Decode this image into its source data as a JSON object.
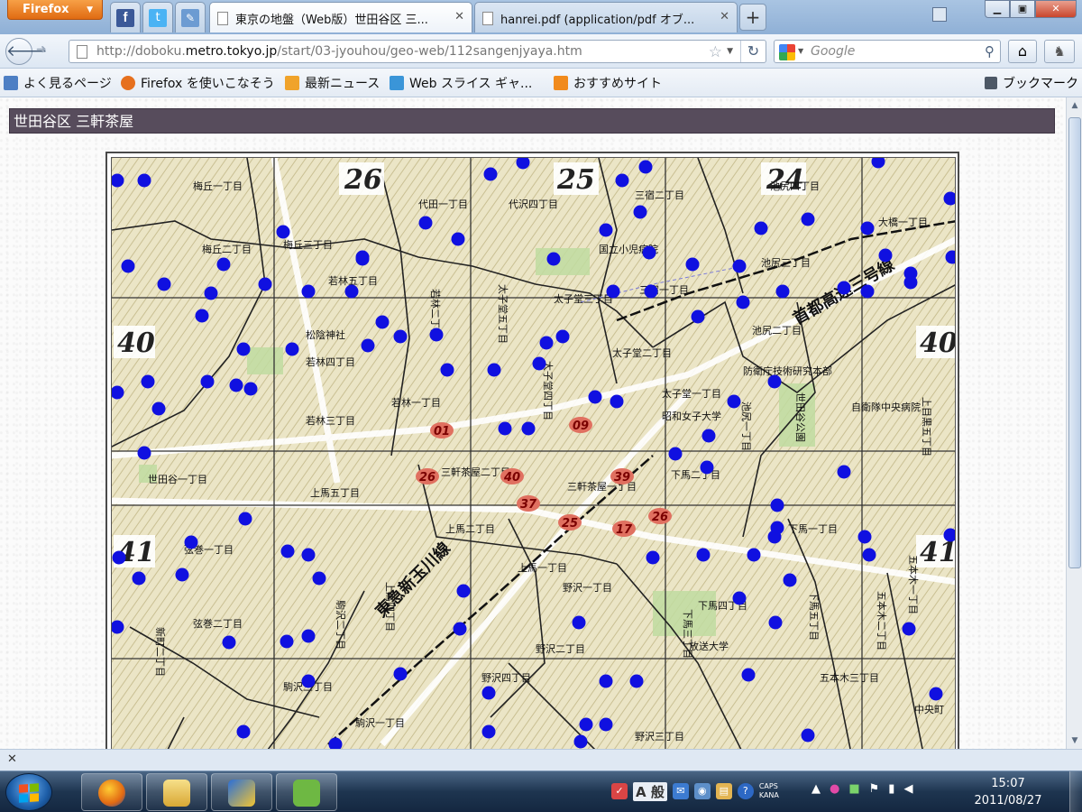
{
  "browser": {
    "menu_button": "Firefox",
    "tabs": [
      {
        "label": "東京の地盤（Web版）世田谷区 三...",
        "active": true
      },
      {
        "label": "hanrei.pdf (application/pdf オブ...",
        "active": false
      }
    ],
    "new_tab": "+",
    "url_host_prefix": "http://doboku.",
    "url_host_domain": "metro.tokyo.jp",
    "url_path": "/start/03-jyouhou/geo-web/112sangenjyaya.htm",
    "search_placeholder": "Google"
  },
  "bookmarks": [
    {
      "label": "よく見るページ",
      "icon": "bookmark-page-icon",
      "color": "#4d7fc4"
    },
    {
      "label": "Firefox を使いこなそう",
      "icon": "firefox-icon",
      "color": "#e6701e"
    },
    {
      "label": "最新ニュース",
      "icon": "rss-icon",
      "color": "#f0a32b"
    },
    {
      "label": "Web スライス ギャ...",
      "icon": "webslice-icon",
      "color": "#3a95d8"
    },
    {
      "label": "おすすめサイト",
      "icon": "bulb-icon",
      "color": "#f18a1c"
    }
  ],
  "bookmarks_menu": "ブックマーク",
  "page": {
    "title": "世田谷区 三軒茶屋"
  },
  "map": {
    "grid_numbers": {
      "top": [
        "26",
        "25",
        "24"
      ],
      "left": [
        "40",
        "41"
      ],
      "right": [
        "40",
        "41"
      ]
    },
    "place_labels": [
      {
        "text": "梅丘一丁目"
      },
      {
        "text": "代田一丁目"
      },
      {
        "text": "代沢四丁目"
      },
      {
        "text": "三宿二丁目"
      },
      {
        "text": "池尻四丁目"
      },
      {
        "text": "大橋一丁目"
      },
      {
        "text": "梅丘二丁目"
      },
      {
        "text": "梅丘三丁目"
      },
      {
        "text": "若林五丁目"
      },
      {
        "text": "若林二丁目"
      },
      {
        "text": "国立小児病院"
      },
      {
        "text": "三宿一丁目"
      },
      {
        "text": "池尻三丁目"
      },
      {
        "text": "池尻二丁目"
      },
      {
        "text": "太子堂五丁目"
      },
      {
        "text": "太子堂三丁目"
      },
      {
        "text": "太子堂二丁目"
      },
      {
        "text": "太子堂四丁目"
      },
      {
        "text": "太子堂一丁目"
      },
      {
        "text": "松陰神社"
      },
      {
        "text": "若林四丁目"
      },
      {
        "text": "若林一丁目"
      },
      {
        "text": "若林三丁目"
      },
      {
        "text": "防衛庁技術研究本部"
      },
      {
        "text": "昭和女子大学"
      },
      {
        "text": "自衛隊中央病院"
      },
      {
        "text": "世田谷一丁目"
      },
      {
        "text": "三軒茶屋二丁目"
      },
      {
        "text": "三軒茶屋一丁目"
      },
      {
        "text": "上馬五丁目"
      },
      {
        "text": "下馬二丁目"
      },
      {
        "text": "上馬二丁目"
      },
      {
        "text": "下馬一丁目"
      },
      {
        "text": "弦巻一丁目"
      },
      {
        "text": "上馬一丁目"
      },
      {
        "text": "野沢一丁目"
      },
      {
        "text": "弦巻二丁目"
      },
      {
        "text": "駒沢二丁目"
      },
      {
        "text": "上馬四丁目"
      },
      {
        "text": "下馬三丁目"
      },
      {
        "text": "下馬四丁目"
      },
      {
        "text": "下馬五丁目"
      },
      {
        "text": "五本木二丁目"
      },
      {
        "text": "新町二丁目"
      },
      {
        "text": "野沢二丁目"
      },
      {
        "text": "放送大学"
      },
      {
        "text": "五本木三丁目"
      },
      {
        "text": "駒沢三丁目"
      },
      {
        "text": "野沢四丁目"
      },
      {
        "text": "駒沢一丁目"
      },
      {
        "text": "野沢三丁目"
      },
      {
        "text": "中央町"
      },
      {
        "text": "東急新玉川線"
      },
      {
        "text": "首都高速三号線"
      },
      {
        "text": "上目黒五丁目"
      },
      {
        "text": "五本木一丁目"
      },
      {
        "text": "世田谷公園"
      },
      {
        "text": "池尻一丁目"
      }
    ],
    "boring_labels": [
      "01",
      "09",
      "26",
      "40",
      "39",
      "37",
      "25",
      "17",
      "26"
    ],
    "point_color": "#1010e0",
    "boring_color": "#e07060"
  },
  "taskbar": {
    "time": "15:07",
    "date": "2011/08/27",
    "ime_mode": "A 般",
    "caps": "CAPS",
    "kana": "KANA"
  }
}
